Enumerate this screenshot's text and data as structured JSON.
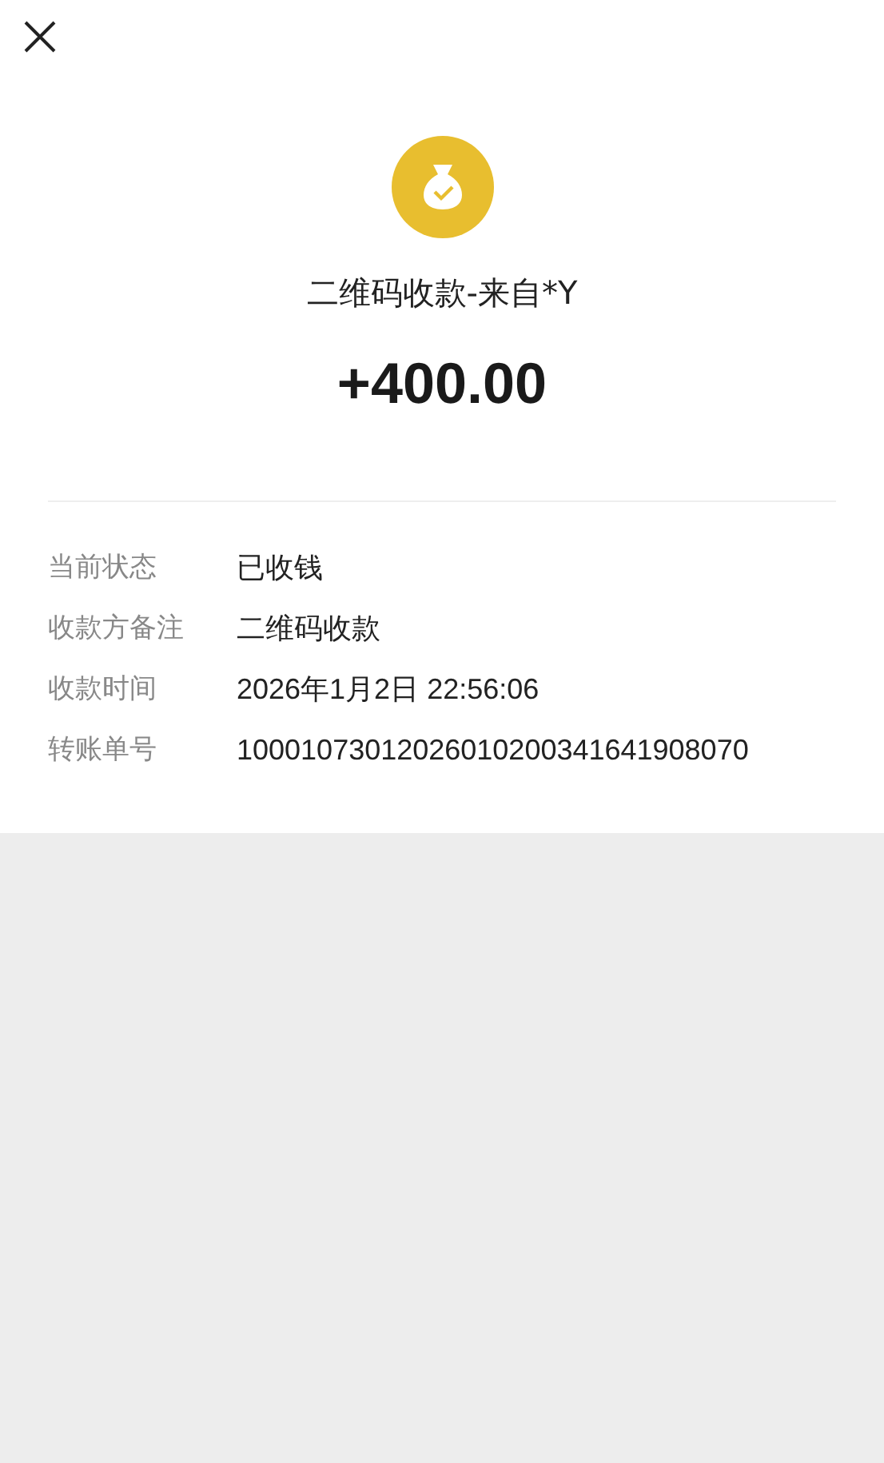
{
  "title": "二维码收款-来自*Y",
  "amount": "+400.00",
  "details": [
    {
      "label": "当前状态",
      "value": "已收钱"
    },
    {
      "label": "收款方备注",
      "value": "二维码收款"
    },
    {
      "label": "收款时间",
      "value": "2026年1月2日 22:56:06"
    },
    {
      "label": "转账单号",
      "value": "10001073012026010200341641908070"
    }
  ]
}
